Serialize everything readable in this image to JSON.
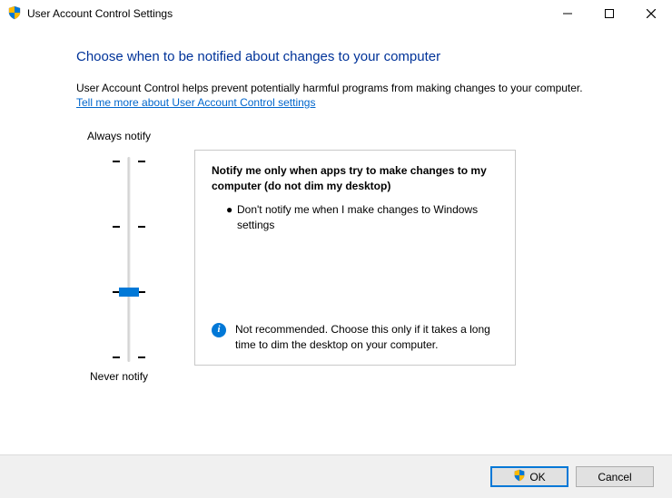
{
  "window": {
    "title": "User Account Control Settings"
  },
  "main": {
    "heading": "Choose when to be notified about changes to your computer",
    "description": "User Account Control helps prevent potentially harmful programs from making changes to your computer.",
    "link": "Tell me more about User Account Control settings"
  },
  "slider": {
    "top_label": "Always notify",
    "bottom_label": "Never notify",
    "levels": 4,
    "selected_index": 2
  },
  "panel": {
    "title": "Notify me only when apps try to make changes to my computer (do not dim my desktop)",
    "bullet": "Don't notify me when I make changes to Windows settings",
    "warning": "Not recommended. Choose this only if it takes a long time to dim the desktop on your computer."
  },
  "buttons": {
    "ok": "OK",
    "cancel": "Cancel"
  }
}
